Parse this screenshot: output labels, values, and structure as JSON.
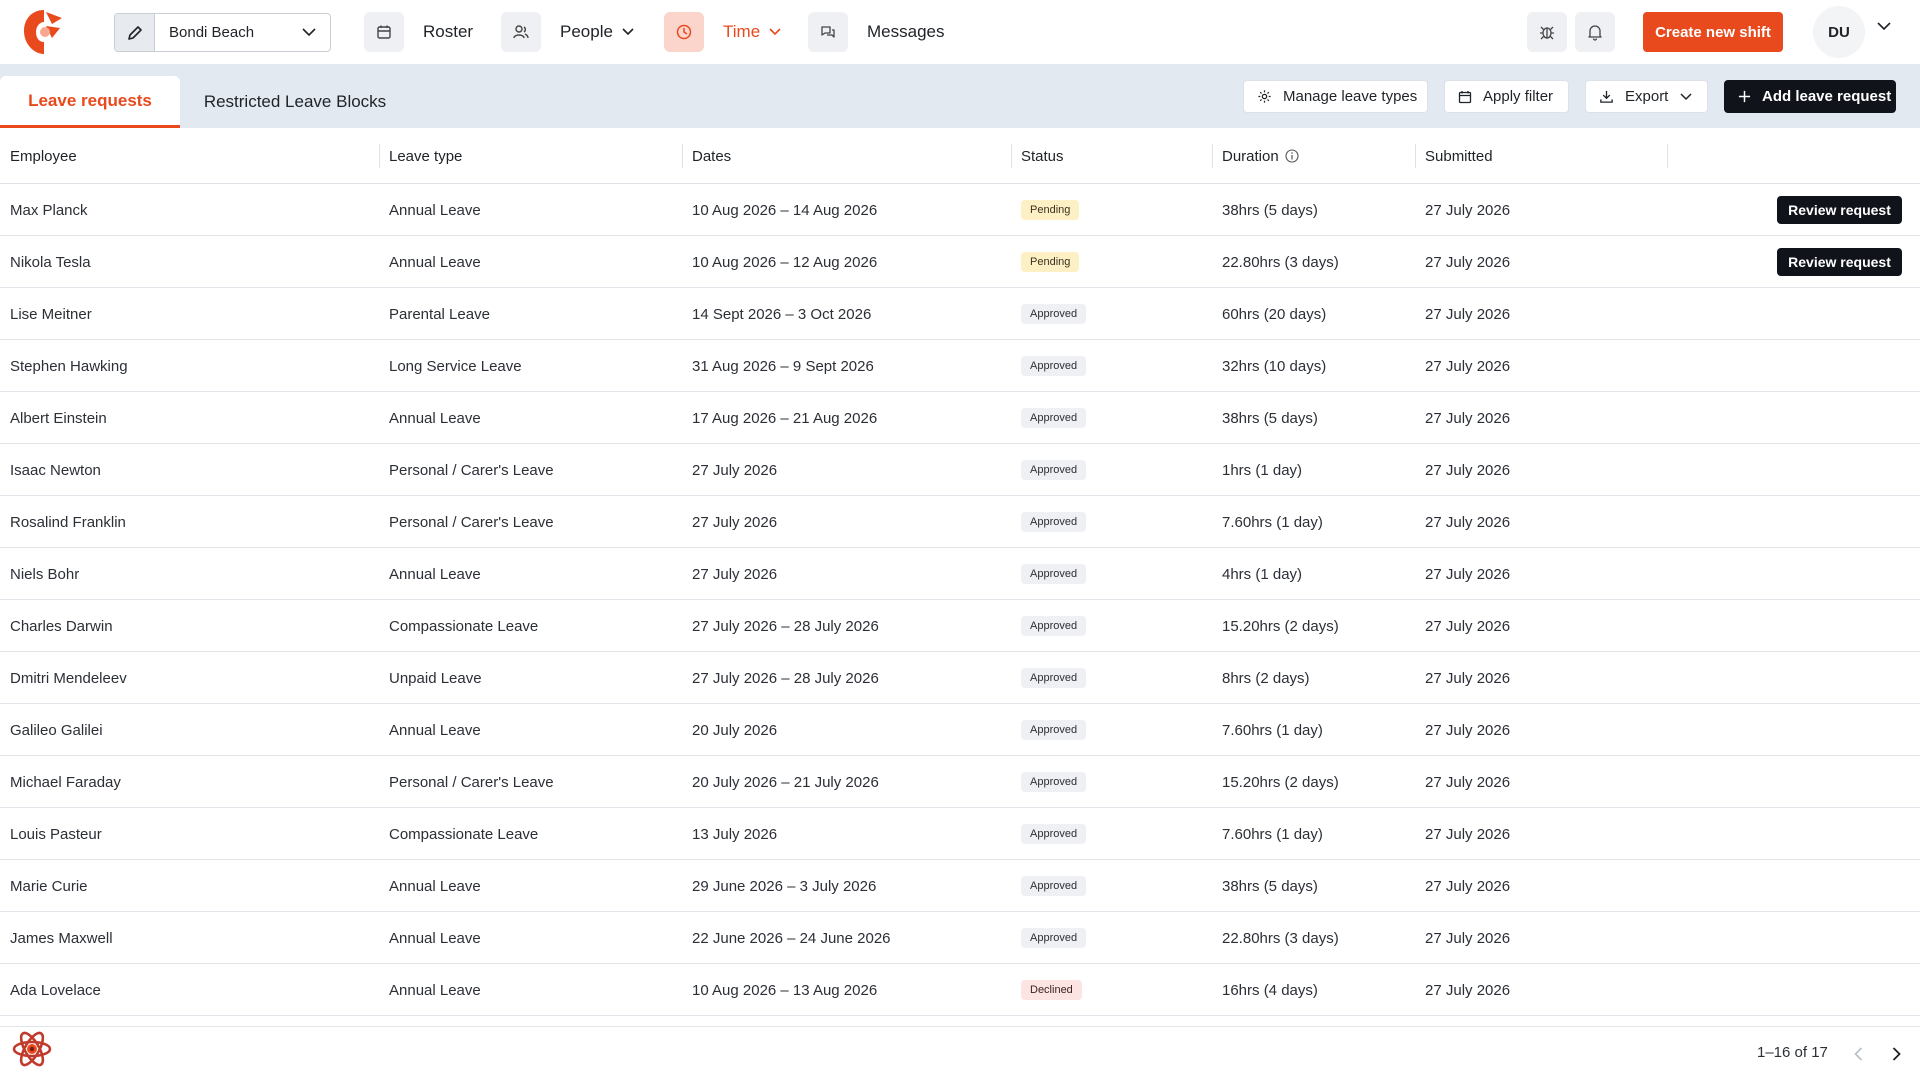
{
  "brand": {
    "accent": "#e8491d",
    "dark": "#10131a",
    "subbar_bg": "#e3e9f0"
  },
  "location": {
    "value": "Bondi Beach"
  },
  "nav": {
    "roster": "Roster",
    "people": "People",
    "time": "Time",
    "messages": "Messages"
  },
  "header": {
    "create_shift": "Create new shift",
    "avatar_initials": "DU"
  },
  "tabs": {
    "leave_requests": "Leave requests",
    "restricted_blocks": "Restricted Leave Blocks"
  },
  "actions": {
    "manage_types": "Manage leave types",
    "apply_filter": "Apply filter",
    "export": "Export",
    "add_request": "Add leave request"
  },
  "table": {
    "columns": {
      "employee": "Employee",
      "leave_type": "Leave type",
      "dates": "Dates",
      "status": "Status",
      "duration": "Duration",
      "submitted": "Submitted"
    },
    "review_label": "Review request",
    "rows": [
      {
        "employee": "Max Planck",
        "leave_type": "Annual Leave",
        "dates": "10 Aug 2026 – 14 Aug 2026",
        "status": "Pending",
        "duration": "38hrs (5 days)",
        "submitted": "27 July 2026",
        "review": true
      },
      {
        "employee": "Nikola Tesla",
        "leave_type": "Annual Leave",
        "dates": "10 Aug 2026 – 12 Aug 2026",
        "status": "Pending",
        "duration": "22.80hrs (3 days)",
        "submitted": "27 July 2026",
        "review": true
      },
      {
        "employee": "Lise Meitner",
        "leave_type": "Parental Leave",
        "dates": "14 Sept 2026 – 3 Oct 2026",
        "status": "Approved",
        "duration": "60hrs (20 days)",
        "submitted": "27 July 2026",
        "review": false
      },
      {
        "employee": "Stephen Hawking",
        "leave_type": "Long Service Leave",
        "dates": "31 Aug 2026 – 9 Sept 2026",
        "status": "Approved",
        "duration": "32hrs (10 days)",
        "submitted": "27 July 2026",
        "review": false
      },
      {
        "employee": "Albert Einstein",
        "leave_type": "Annual Leave",
        "dates": "17 Aug 2026 – 21 Aug 2026",
        "status": "Approved",
        "duration": "38hrs (5 days)",
        "submitted": "27 July 2026",
        "review": false
      },
      {
        "employee": "Isaac Newton",
        "leave_type": "Personal / Carer's Leave",
        "dates": "27 July 2026",
        "status": "Approved",
        "duration": "1hrs (1 day)",
        "submitted": "27 July 2026",
        "review": false
      },
      {
        "employee": "Rosalind Franklin",
        "leave_type": "Personal / Carer's Leave",
        "dates": "27 July 2026",
        "status": "Approved",
        "duration": "7.60hrs (1 day)",
        "submitted": "27 July 2026",
        "review": false
      },
      {
        "employee": "Niels Bohr",
        "leave_type": "Annual Leave",
        "dates": "27 July 2026",
        "status": "Approved",
        "duration": "4hrs (1 day)",
        "submitted": "27 July 2026",
        "review": false
      },
      {
        "employee": "Charles Darwin",
        "leave_type": "Compassionate Leave",
        "dates": "27 July 2026 – 28 July 2026",
        "status": "Approved",
        "duration": "15.20hrs (2 days)",
        "submitted": "27 July 2026",
        "review": false
      },
      {
        "employee": "Dmitri Mendeleev",
        "leave_type": "Unpaid Leave",
        "dates": "27 July 2026 – 28 July 2026",
        "status": "Approved",
        "duration": "8hrs (2 days)",
        "submitted": "27 July 2026",
        "review": false
      },
      {
        "employee": "Galileo Galilei",
        "leave_type": "Annual Leave",
        "dates": "20 July 2026",
        "status": "Approved",
        "duration": "7.60hrs (1 day)",
        "submitted": "27 July 2026",
        "review": false
      },
      {
        "employee": "Michael Faraday",
        "leave_type": "Personal / Carer's Leave",
        "dates": "20 July 2026 – 21 July 2026",
        "status": "Approved",
        "duration": "15.20hrs (2 days)",
        "submitted": "27 July 2026",
        "review": false
      },
      {
        "employee": "Louis Pasteur",
        "leave_type": "Compassionate Leave",
        "dates": "13 July 2026",
        "status": "Approved",
        "duration": "7.60hrs (1 day)",
        "submitted": "27 July 2026",
        "review": false
      },
      {
        "employee": "Marie Curie",
        "leave_type": "Annual Leave",
        "dates": "29 June 2026 – 3 July 2026",
        "status": "Approved",
        "duration": "38hrs (5 days)",
        "submitted": "27 July 2026",
        "review": false
      },
      {
        "employee": "James Maxwell",
        "leave_type": "Annual Leave",
        "dates": "22 June 2026 – 24 June 2026",
        "status": "Approved",
        "duration": "22.80hrs (3 days)",
        "submitted": "27 July 2026",
        "review": false
      },
      {
        "employee": "Ada Lovelace",
        "leave_type": "Annual Leave",
        "dates": "10 Aug 2026 – 13 Aug 2026",
        "status": "Declined",
        "duration": "16hrs (4 days)",
        "submitted": "27 July 2026",
        "review": false
      }
    ]
  },
  "pagination": {
    "label": "1–16 of 17"
  }
}
